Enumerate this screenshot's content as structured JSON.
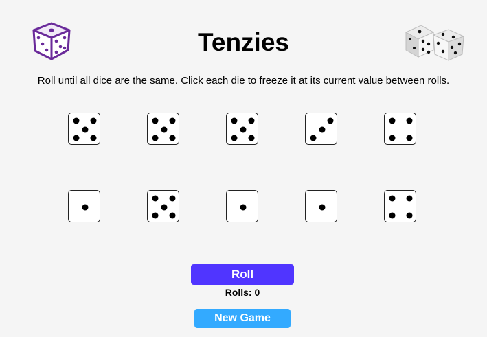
{
  "header": {
    "title": "Tenzies",
    "left_icon": "purple-die-icon",
    "right_icon": "two-dice-icon"
  },
  "instructions": "Roll until all dice are the same. Click each die to freeze it at its current value between rolls.",
  "dice": [
    {
      "value": 5,
      "held": false
    },
    {
      "value": 5,
      "held": false
    },
    {
      "value": 5,
      "held": false
    },
    {
      "value": 3,
      "held": false
    },
    {
      "value": 4,
      "held": false
    },
    {
      "value": 1,
      "held": false
    },
    {
      "value": 5,
      "held": false
    },
    {
      "value": 1,
      "held": false
    },
    {
      "value": 1,
      "held": false
    },
    {
      "value": 4,
      "held": false
    }
  ],
  "controls": {
    "roll_label": "Roll",
    "rolls_text": "Rolls: 0",
    "new_game_label": "New Game"
  },
  "colors": {
    "roll_button": "#5035ff",
    "new_game_button": "#33aaff",
    "logo_purple": "#6a2a9a",
    "die_face": "#ffffff",
    "pip": "#000000"
  }
}
